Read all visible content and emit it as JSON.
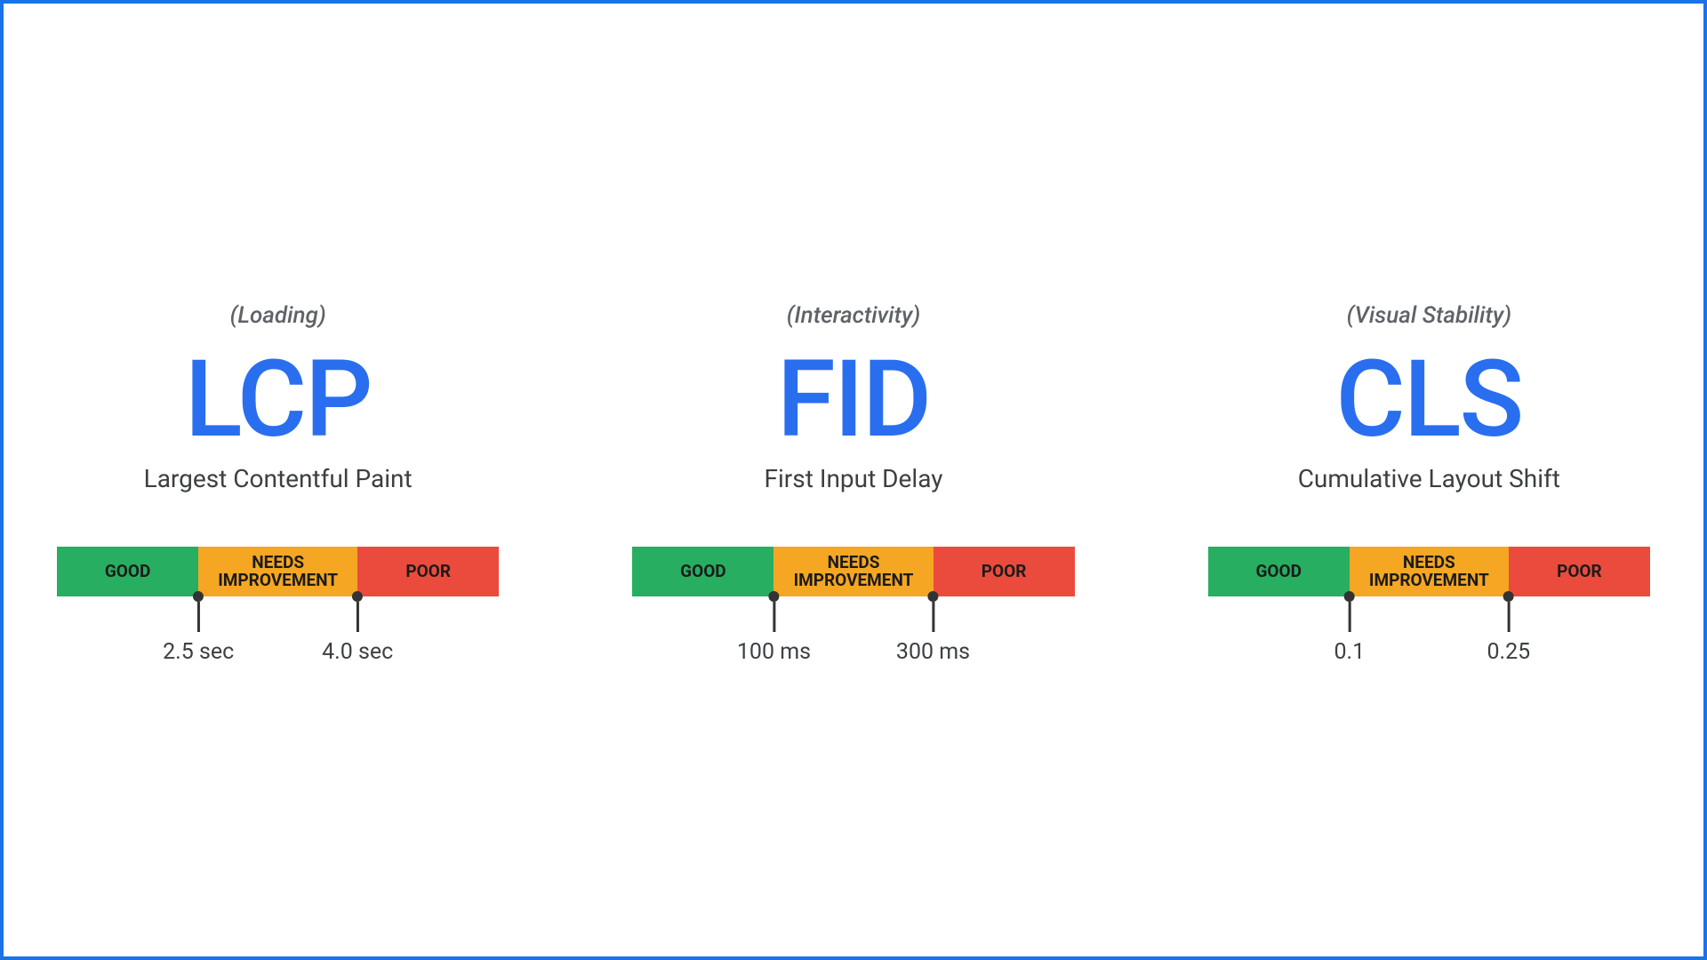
{
  "colors": {
    "good": "#27ae60",
    "needs": "#f5a623",
    "poor": "#eb4b3d",
    "accent": "#2a6ef0",
    "border": "#1a73e8"
  },
  "labels": {
    "good": "GOOD",
    "needs_line1": "NEEDS",
    "needs_line2": "IMPROVEMENT",
    "poor": "POOR"
  },
  "metrics": [
    {
      "category": "(Loading)",
      "abbrev": "LCP",
      "fullname": "Largest Contentful Paint",
      "threshold_good": "2.5 sec",
      "threshold_poor": "4.0 sec"
    },
    {
      "category": "(Interactivity)",
      "abbrev": "FID",
      "fullname": "First Input Delay",
      "threshold_good": "100 ms",
      "threshold_poor": "300 ms"
    },
    {
      "category": "(Visual Stability)",
      "abbrev": "CLS",
      "fullname": "Cumulative Layout Shift",
      "threshold_good": "0.1",
      "threshold_poor": "0.25"
    }
  ]
}
